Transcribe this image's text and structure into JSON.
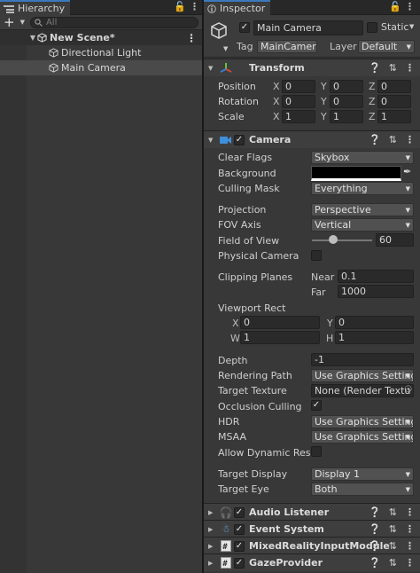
{
  "hierarchy": {
    "tab": "Hierarchy",
    "search_placeholder": "All",
    "scene": "New Scene*",
    "items": [
      "Directional Light",
      "Main Camera"
    ]
  },
  "inspector": {
    "tab": "Inspector",
    "object_name": "Main Camera",
    "static_label": "Static",
    "tag_label": "Tag",
    "tag_value": "MainCamer",
    "layer_label": "Layer",
    "layer_value": "Default",
    "transform": {
      "title": "Transform",
      "position_label": "Position",
      "rotation_label": "Rotation",
      "scale_label": "Scale",
      "axis": [
        "X",
        "Y",
        "Z"
      ],
      "position": [
        "0",
        "0",
        "0"
      ],
      "rotation": [
        "0",
        "0",
        "0"
      ],
      "scale": [
        "1",
        "1",
        "1"
      ]
    },
    "camera": {
      "title": "Camera",
      "clear_flags_label": "Clear Flags",
      "clear_flags": "Skybox",
      "background_label": "Background",
      "culling_mask_label": "Culling Mask",
      "culling_mask": "Everything",
      "projection_label": "Projection",
      "projection": "Perspective",
      "fov_axis_label": "FOV Axis",
      "fov_axis": "Vertical",
      "fov_label": "Field of View",
      "fov": "60",
      "physical_label": "Physical Camera",
      "clipping_label": "Clipping Planes",
      "near_label": "Near",
      "near": "0.1",
      "far_label": "Far",
      "far": "1000",
      "viewport_label": "Viewport Rect",
      "vx_label": "X",
      "vx": "0",
      "vy_label": "Y",
      "vy": "0",
      "vw_label": "W",
      "vw": "1",
      "vh_label": "H",
      "vh": "1",
      "depth_label": "Depth",
      "depth": "-1",
      "rendering_label": "Rendering Path",
      "rendering": "Use Graphics Setting",
      "target_texture_label": "Target Texture",
      "target_texture": "None (Render Textu",
      "occlusion_label": "Occlusion Culling",
      "hdr_label": "HDR",
      "hdr": "Use Graphics Setting",
      "msaa_label": "MSAA",
      "msaa": "Use Graphics Setting",
      "dynres_label": "Allow Dynamic Resol",
      "target_display_label": "Target Display",
      "target_display": "Display 1",
      "target_eye_label": "Target Eye",
      "target_eye": "Both"
    },
    "components": [
      "Audio Listener",
      "Event System",
      "MixedRealityInputModule",
      "GazeProvider"
    ]
  }
}
